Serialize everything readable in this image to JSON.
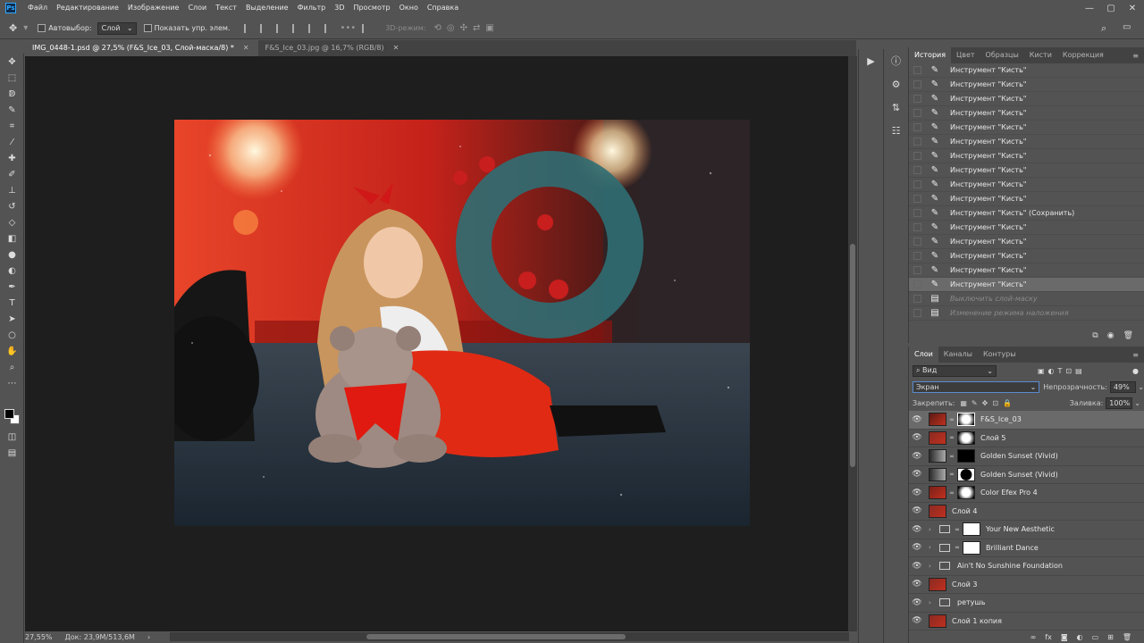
{
  "app": {
    "logo": "Ps"
  },
  "menu": [
    "Файл",
    "Редактирование",
    "Изображение",
    "Слои",
    "Текст",
    "Выделение",
    "Фильтр",
    "3D",
    "Просмотр",
    "Окно",
    "Справка"
  ],
  "window_controls": {
    "minimize": "—",
    "maximize": "▢",
    "close": "✕"
  },
  "options": {
    "autoselect_label": "Автовыбор:",
    "autoselect_value": "Слой",
    "show_controls_label": "Показать упр. элем.",
    "mode3d_label": "3D-режим:"
  },
  "tabs": [
    {
      "label": "IMG_0448-1.psd @ 27,5% (F&S_Ice_03, Слой-маска/8) *",
      "close": "✕"
    },
    {
      "label": "F&S_Ice_03.jpg @ 16,7% (RGB/8)",
      "close": "✕"
    }
  ],
  "status": {
    "zoom": "27,55%",
    "doc": "Док: 23,9М/513,6М"
  },
  "history_panel": {
    "tabs": [
      "История",
      "Цвет",
      "Образцы",
      "Кисти",
      "Коррекция"
    ],
    "items": [
      {
        "label": "Инструмент \"Кисть\"",
        "state": "normal"
      },
      {
        "label": "Инструмент \"Кисть\"",
        "state": "normal"
      },
      {
        "label": "Инструмент \"Кисть\"",
        "state": "normal"
      },
      {
        "label": "Инструмент \"Кисть\"",
        "state": "normal"
      },
      {
        "label": "Инструмент \"Кисть\"",
        "state": "normal"
      },
      {
        "label": "Инструмент \"Кисть\"",
        "state": "normal"
      },
      {
        "label": "Инструмент \"Кисть\"",
        "state": "normal"
      },
      {
        "label": "Инструмент \"Кисть\"",
        "state": "normal"
      },
      {
        "label": "Инструмент \"Кисть\"",
        "state": "normal"
      },
      {
        "label": "Инструмент \"Кисть\"",
        "state": "normal"
      },
      {
        "label": "Инструмент \"Кисть\" (Сохранить)",
        "state": "normal"
      },
      {
        "label": "Инструмент \"Кисть\"",
        "state": "normal"
      },
      {
        "label": "Инструмент \"Кисть\"",
        "state": "normal"
      },
      {
        "label": "Инструмент \"Кисть\"",
        "state": "normal"
      },
      {
        "label": "Инструмент \"Кисть\"",
        "state": "normal"
      },
      {
        "label": "Инструмент \"Кисть\"",
        "state": "current"
      },
      {
        "label": "Выключить слой-маску",
        "state": "undone"
      },
      {
        "label": "Изменение режима наложения",
        "state": "undone"
      }
    ]
  },
  "layers_panel": {
    "tabs": [
      "Слои",
      "Каналы",
      "Контуры"
    ],
    "kind_label": "Вид",
    "blend_mode": "Экран",
    "opacity_label": "Непрозрачность:",
    "opacity_value": "49%",
    "lock_label": "Закрепить:",
    "fill_label": "Заливка:",
    "fill_value": "100%",
    "layers": [
      {
        "name": "F&S_Ice_03",
        "kind": "masked",
        "selected": true
      },
      {
        "name": "Слой 5",
        "kind": "masked",
        "selected": false
      },
      {
        "name": "Golden Sunset  (Vivid)",
        "kind": "masked",
        "selected": false
      },
      {
        "name": "Golden Sunset  (Vivid)",
        "kind": "masked",
        "selected": false
      },
      {
        "name": "Color Efex Pro 4",
        "kind": "masked",
        "selected": false
      },
      {
        "name": "Слой 4",
        "kind": "pixel",
        "selected": false
      },
      {
        "name": "Your New Aesthetic",
        "kind": "group-masked",
        "selected": false
      },
      {
        "name": "Brilliant Dance",
        "kind": "group-masked",
        "selected": false
      },
      {
        "name": "Ain't No Sunshine Foundation",
        "kind": "group",
        "selected": false
      },
      {
        "name": "Слой 3",
        "kind": "pixel",
        "selected": false
      },
      {
        "name": "ретушь",
        "kind": "group",
        "selected": false
      },
      {
        "name": "Слой 1 копия",
        "kind": "pixel",
        "selected": false
      }
    ]
  }
}
